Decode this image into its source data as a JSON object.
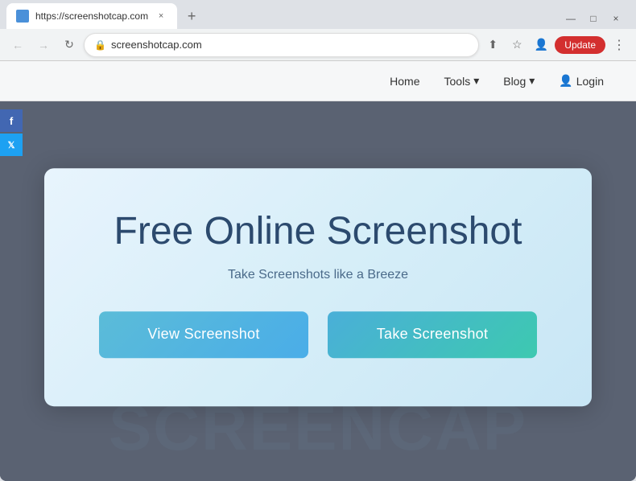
{
  "browser": {
    "tab": {
      "favicon_color": "#4a90d9",
      "title": "https://screenshotcap.com",
      "close_icon": "×"
    },
    "new_tab_icon": "+",
    "window_controls": {
      "minimize": "—",
      "maximize": "□",
      "close": "×"
    },
    "address_bar": {
      "back_icon": "←",
      "forward_icon": "→",
      "refresh_icon": "↻",
      "url": "screenshotcap.com",
      "lock_icon": "🔒",
      "share_icon": "⬆",
      "bookmark_icon": "☆",
      "profile_icon": "👤",
      "update_label": "Update",
      "menu_icon": "⋮"
    }
  },
  "website": {
    "nav": {
      "items": [
        {
          "label": "Home",
          "has_dropdown": false
        },
        {
          "label": "Tools",
          "has_dropdown": true
        },
        {
          "label": "Blog",
          "has_dropdown": true
        },
        {
          "label": "Login",
          "has_icon": true
        }
      ]
    },
    "social": [
      {
        "label": "f",
        "platform": "facebook"
      },
      {
        "label": "𝕏",
        "platform": "twitter"
      }
    ],
    "watermark_text": "SCREENCAP",
    "hero": {
      "title": "Free Online Screenshot",
      "subtitle": "Take Screenshots like a Breeze",
      "btn_view": "View Screenshot",
      "btn_take": "Take Screenshot"
    }
  }
}
